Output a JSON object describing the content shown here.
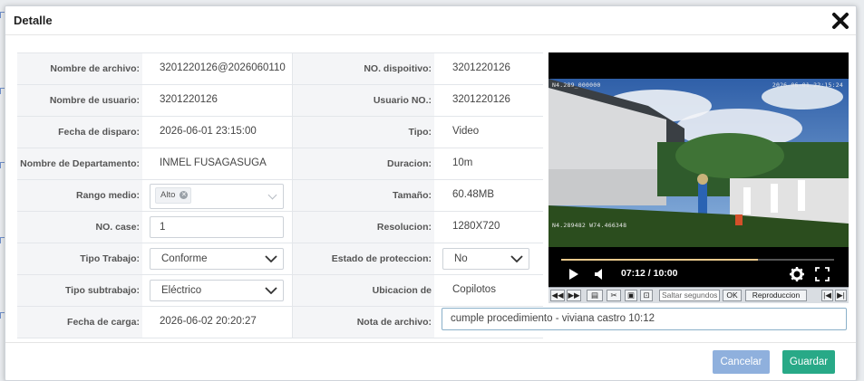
{
  "modal": {
    "title": "Detalle",
    "close_icon": "close-x-icon"
  },
  "fields": {
    "nombre_archivo": {
      "label": "Nombre de archivo:",
      "value": "3201220126@2026060110"
    },
    "no_dispositivo": {
      "label": "NO. dispoitivo:",
      "value": "3201220126"
    },
    "nombre_usuario": {
      "label": "Nombre de usuario:",
      "value": "3201220126"
    },
    "usuario_no": {
      "label": "Usuario NO.:",
      "value": "3201220126"
    },
    "fecha_disparo": {
      "label": "Fecha de disparo:",
      "value": "2026-06-01 23:15:00"
    },
    "tipo": {
      "label": "Tipo:",
      "value": "Video"
    },
    "nombre_departamento": {
      "label": "Nombre de Departamento:",
      "value": "INMEL FUSAGASUGA"
    },
    "duracion": {
      "label": "Duracion:",
      "value": "10m"
    },
    "rango_medio": {
      "label": "Rango medio:",
      "tag": "Alto"
    },
    "tamano": {
      "label": "Tamaño:",
      "value": "60.48MB"
    },
    "no_case": {
      "label": "NO. case:",
      "value": "1"
    },
    "resolucion": {
      "label": "Resolucion:",
      "value": "1280X720"
    },
    "tipo_trabajo": {
      "label": "Tipo Trabajo:",
      "value": "Conforme"
    },
    "estado_proteccion": {
      "label": "Estado de proteccion:",
      "value": "No"
    },
    "tipo_subtrabajo": {
      "label": "Tipo subtrabajo:",
      "value": "Eléctrico"
    },
    "ubicacion": {
      "label": "Ubicacion de almacenamiento:",
      "value": "Copilotos"
    },
    "fecha_carga": {
      "label": "Fecha de carga:",
      "value": "2026-06-02 20:20:27"
    },
    "nota_archivo": {
      "label": "Nota de archivo:",
      "value": "cumple procedimiento - viviana castro  10:12"
    }
  },
  "player": {
    "osd_top_left": "N4.289_000000",
    "osd_top_right": "2026-06-01 22:15:24",
    "osd_bottom_left": "N4.289482 W74.466348",
    "time": "07:12 / 10:00",
    "progress": 0.72,
    "seek_placeholder": "Saltar segundos",
    "ok_label": "OK",
    "playback_label": "Reproduccion",
    "accent_color": "#e8c88c"
  },
  "footer": {
    "cancel_label": "Cancelar",
    "save_label": "Guardar",
    "cancel_color": "#8fb0dd",
    "save_color": "#28a987"
  }
}
